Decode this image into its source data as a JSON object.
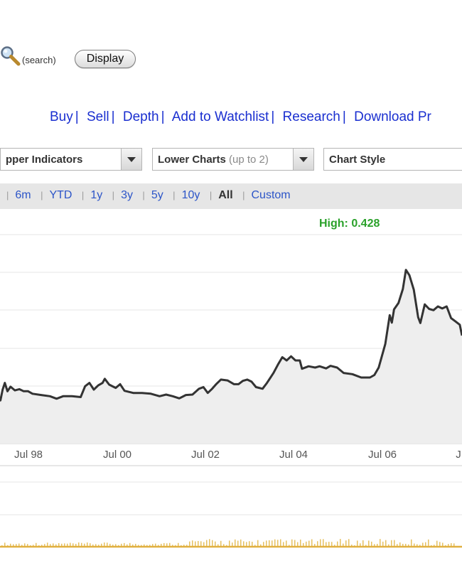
{
  "search": {
    "hint": "(search)",
    "display_label": "Display"
  },
  "actions": [
    "Buy",
    "Sell",
    "Depth",
    "Add to Watchlist",
    "Research",
    "Download Pr"
  ],
  "action_separator": "|",
  "dropdowns": {
    "upper": {
      "label": "pper Indicators"
    },
    "lower": {
      "label": "Lower Charts",
      "note": "(up to 2)"
    },
    "style": {
      "label": "Chart Style"
    }
  },
  "ranges": [
    "6m",
    "YTD",
    "1y",
    "3y",
    "5y",
    "10y",
    "All",
    "Custom"
  ],
  "range_active": "All",
  "range_separator": "|",
  "high_label": "High: 0.428",
  "colors": {
    "link": "#1a2fd0",
    "range_link": "#2c55c8",
    "high": "#2aa12a",
    "line": "#333333",
    "volume": "#e0b040"
  },
  "chart_data": {
    "type": "area",
    "x_ticks": [
      "Jul 98",
      "Jul 00",
      "Jul 02",
      "Jul 04",
      "Jul 06",
      "J"
    ],
    "x_range": [
      1997.0,
      2007.8
    ],
    "y_range": [
      0.0,
      0.46
    ],
    "points": [
      [
        1997.0,
        0.131
      ],
      [
        1997.05,
        0.141
      ],
      [
        1997.1,
        0.146
      ],
      [
        1997.15,
        0.139
      ],
      [
        1997.2,
        0.122
      ],
      [
        1997.27,
        0.104
      ],
      [
        1997.32,
        0.13
      ],
      [
        1997.37,
        0.146
      ],
      [
        1997.43,
        0.126
      ],
      [
        1997.5,
        0.137
      ],
      [
        1997.6,
        0.128
      ],
      [
        1997.7,
        0.131
      ],
      [
        1997.8,
        0.126
      ],
      [
        1997.9,
        0.126
      ],
      [
        1998.0,
        0.12
      ],
      [
        1998.2,
        0.117
      ],
      [
        1998.4,
        0.114
      ],
      [
        1998.55,
        0.108
      ],
      [
        1998.7,
        0.114
      ],
      [
        1998.9,
        0.114
      ],
      [
        1999.1,
        0.112
      ],
      [
        1999.2,
        0.138
      ],
      [
        1999.3,
        0.146
      ],
      [
        1999.4,
        0.13
      ],
      [
        1999.5,
        0.14
      ],
      [
        1999.6,
        0.146
      ],
      [
        1999.65,
        0.156
      ],
      [
        1999.75,
        0.142
      ],
      [
        1999.9,
        0.134
      ],
      [
        2000.0,
        0.143
      ],
      [
        2000.1,
        0.127
      ],
      [
        2000.3,
        0.122
      ],
      [
        2000.5,
        0.122
      ],
      [
        2000.7,
        0.12
      ],
      [
        2000.9,
        0.114
      ],
      [
        2001.05,
        0.118
      ],
      [
        2001.2,
        0.114
      ],
      [
        2001.35,
        0.109
      ],
      [
        2001.5,
        0.117
      ],
      [
        2001.65,
        0.118
      ],
      [
        2001.8,
        0.132
      ],
      [
        2001.9,
        0.136
      ],
      [
        2002.0,
        0.122
      ],
      [
        2002.1,
        0.132
      ],
      [
        2002.2,
        0.144
      ],
      [
        2002.3,
        0.154
      ],
      [
        2002.45,
        0.152
      ],
      [
        2002.6,
        0.143
      ],
      [
        2002.7,
        0.143
      ],
      [
        2002.8,
        0.151
      ],
      [
        2002.9,
        0.154
      ],
      [
        2003.0,
        0.149
      ],
      [
        2003.1,
        0.136
      ],
      [
        2003.25,
        0.132
      ],
      [
        2003.35,
        0.146
      ],
      [
        2003.5,
        0.17
      ],
      [
        2003.6,
        0.19
      ],
      [
        2003.7,
        0.208
      ],
      [
        2003.8,
        0.2
      ],
      [
        2003.9,
        0.21
      ],
      [
        2004.0,
        0.2
      ],
      [
        2004.1,
        0.2
      ],
      [
        2004.15,
        0.18
      ],
      [
        2004.3,
        0.186
      ],
      [
        2004.45,
        0.183
      ],
      [
        2004.55,
        0.186
      ],
      [
        2004.7,
        0.181
      ],
      [
        2004.8,
        0.187
      ],
      [
        2004.95,
        0.183
      ],
      [
        2005.1,
        0.17
      ],
      [
        2005.3,
        0.167
      ],
      [
        2005.5,
        0.159
      ],
      [
        2005.7,
        0.159
      ],
      [
        2005.8,
        0.165
      ],
      [
        2005.9,
        0.183
      ],
      [
        2006.05,
        0.24
      ],
      [
        2006.15,
        0.309
      ],
      [
        2006.2,
        0.291
      ],
      [
        2006.25,
        0.323
      ],
      [
        2006.35,
        0.338
      ],
      [
        2006.45,
        0.372
      ],
      [
        2006.52,
        0.418
      ],
      [
        2006.6,
        0.405
      ],
      [
        2006.7,
        0.37
      ],
      [
        2006.8,
        0.304
      ],
      [
        2006.85,
        0.29
      ],
      [
        2006.95,
        0.335
      ],
      [
        2007.05,
        0.324
      ],
      [
        2007.15,
        0.321
      ],
      [
        2007.25,
        0.33
      ],
      [
        2007.35,
        0.325
      ],
      [
        2007.45,
        0.33
      ],
      [
        2007.55,
        0.302
      ],
      [
        2007.65,
        0.294
      ],
      [
        2007.75,
        0.286
      ],
      [
        2007.8,
        0.26
      ]
    ]
  }
}
